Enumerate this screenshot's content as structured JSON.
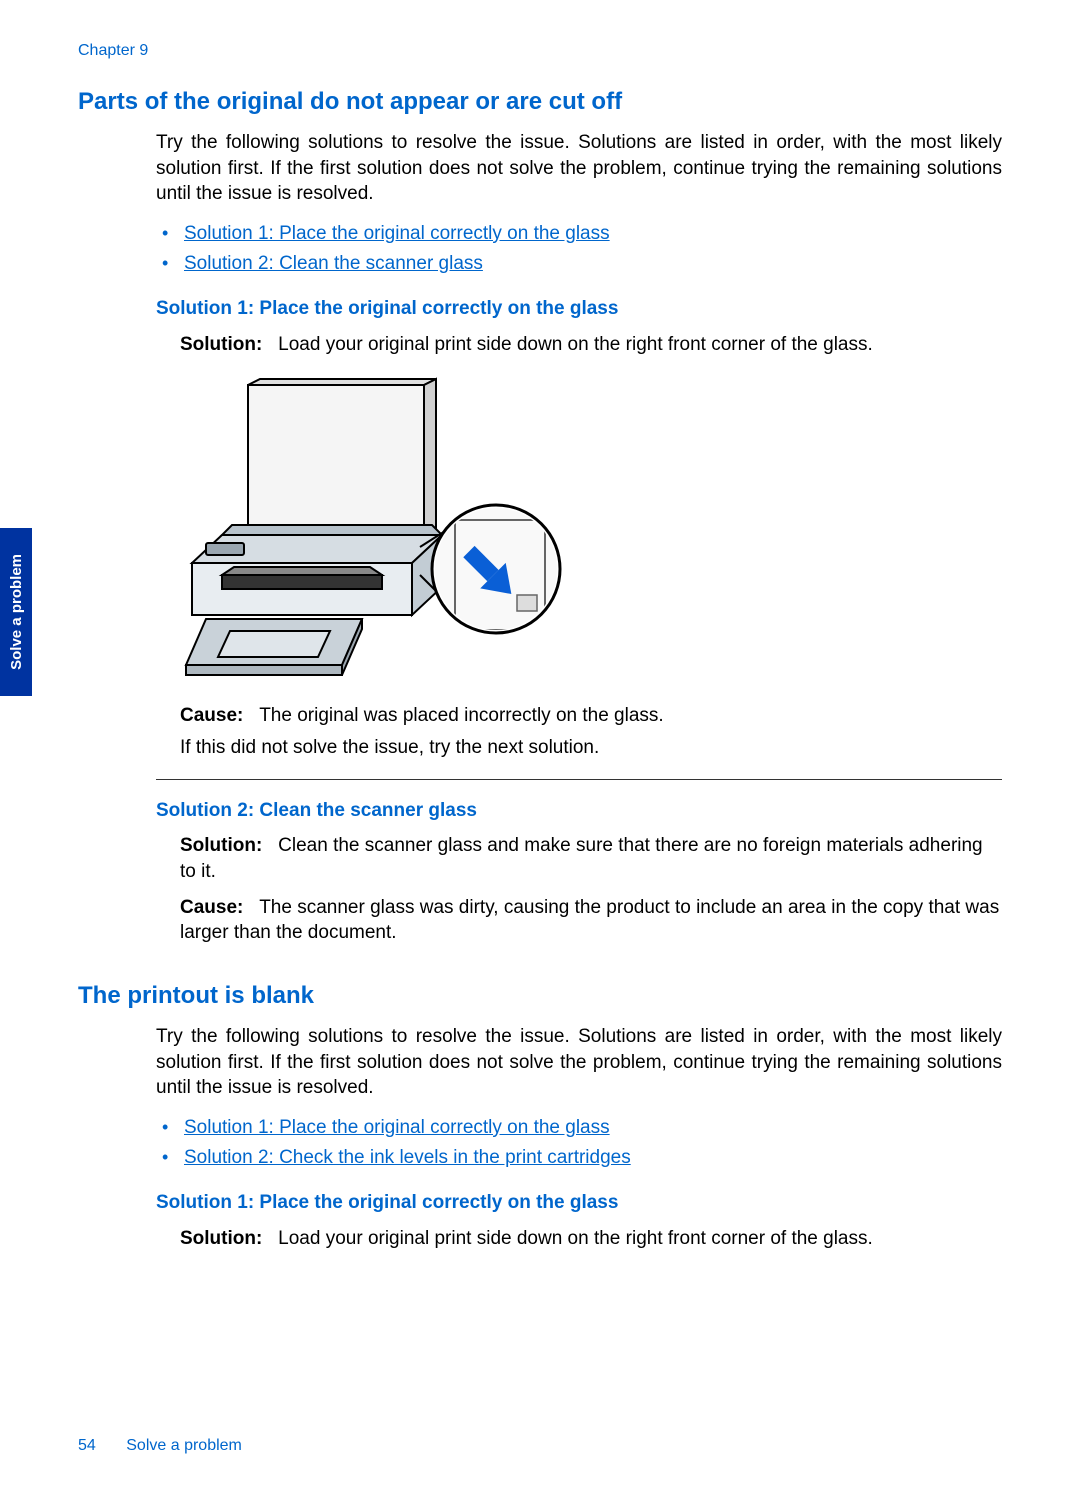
{
  "header": {
    "chapter": "Chapter 9"
  },
  "sideTab": "Solve a problem",
  "footer": {
    "page": "54",
    "section": "Solve a problem"
  },
  "section1": {
    "title": "Parts of the original do not appear or are cut off",
    "intro": "Try the following solutions to resolve the issue. Solutions are listed in order, with the most likely solution first. If the first solution does not solve the problem, continue trying the remaining solutions until the issue is resolved.",
    "links": {
      "l1": "Solution 1: Place the original correctly on the glass",
      "l2": "Solution 2: Clean the scanner glass"
    },
    "sol1": {
      "heading": "Solution 1: Place the original correctly on the glass",
      "label": "Solution:",
      "text": "Load your original print side down on the right front corner of the glass.",
      "causeLabel": "Cause:",
      "causeText": "The original was placed incorrectly on the glass.",
      "next": "If this did not solve the issue, try the next solution."
    },
    "sol2": {
      "heading": "Solution 2: Clean the scanner glass",
      "label": "Solution:",
      "text": "Clean the scanner glass and make sure that there are no foreign materials adhering to it.",
      "causeLabel": "Cause:",
      "causeText": "The scanner glass was dirty, causing the product to include an area in the copy that was larger than the document."
    }
  },
  "section2": {
    "title": "The printout is blank",
    "intro": "Try the following solutions to resolve the issue. Solutions are listed in order, with the most likely solution first. If the first solution does not solve the problem, continue trying the remaining solutions until the issue is resolved.",
    "links": {
      "l1": "Solution 1: Place the original correctly on the glass",
      "l2": "Solution 2: Check the ink levels in the print cartridges"
    },
    "sol1": {
      "heading": "Solution 1: Place the original correctly on the glass",
      "label": "Solution:",
      "text": "Load your original print side down on the right front corner of the glass."
    }
  }
}
